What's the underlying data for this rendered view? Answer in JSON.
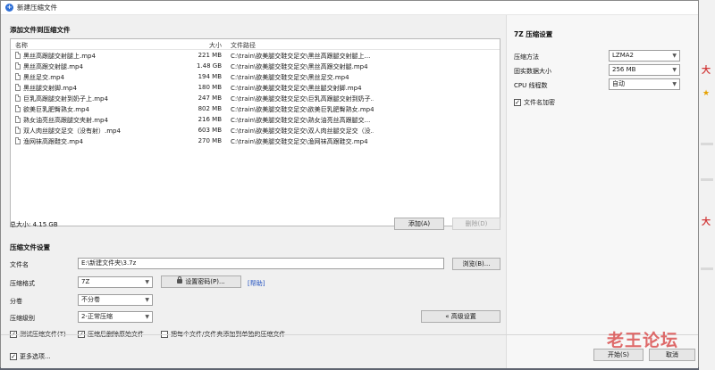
{
  "window": {
    "title": "新建压缩文件"
  },
  "files_section": {
    "title": "添加文件到压缩文件",
    "columns": {
      "name": "名称",
      "size": "大小",
      "path": "文件路径"
    },
    "rows": [
      {
        "name": "黑丝高跟腿交射腿上.mp4",
        "size": "221 MB",
        "path": "C:\\train\\欲美腿交鞋交足交\\黑丝高跟腿交射腿上..."
      },
      {
        "name": "黑丝高跟交射腿.mp4",
        "size": "1.48 GB",
        "path": "C:\\train\\欲美腿交鞋交足交\\黑丝高跟交射腿.mp4"
      },
      {
        "name": "黑丝足交.mp4",
        "size": "194 MB",
        "path": "C:\\train\\欲美腿交鞋交足交\\黑丝足交.mp4"
      },
      {
        "name": "黑丝腿交射脚.mp4",
        "size": "180 MB",
        "path": "C:\\train\\欲美腿交鞋交足交\\黑丝腿交射脚.mp4"
      },
      {
        "name": "巨乳高跟腿交射到奶子上.mp4",
        "size": "247 MB",
        "path": "C:\\train\\欲美腿交鞋交足交\\巨乳高跟腿交射到奶子..."
      },
      {
        "name": "欲美巨乳肥臀熟女.mp4",
        "size": "802 MB",
        "path": "C:\\train\\欲美腿交鞋交足交\\欲美巨乳肥臀熟女.mp4"
      },
      {
        "name": "熟女油亮丝高跟腿交夹射.mp4",
        "size": "216 MB",
        "path": "C:\\train\\欲美腿交鞋交足交\\熟女油亮丝高跟腿交..."
      },
      {
        "name": "双人肉丝腿交足交（没有射）.mp4",
        "size": "603 MB",
        "path": "C:\\train\\欲美腿交鞋交足交\\双人肉丝腿交足交（没..."
      },
      {
        "name": "渔网袜高跟鞋交.mp4",
        "size": "270 MB",
        "path": "C:\\train\\欲美腿交鞋交足交\\渔网袜高跟鞋交.mp4"
      }
    ],
    "total_size": "总大小: 4.15 GB",
    "add_label": "添加(A)",
    "delete_label": "删除(D)"
  },
  "settings_section": {
    "title": "压缩文件设置",
    "filename_label": "文件名",
    "filename_value": "E:\\新建文件夹\\3.7z",
    "browse_label": "浏览(B)...",
    "format_label": "压缩格式",
    "format_value": "7Z",
    "set_password_label": "设置密码(P)...",
    "help_label": "[帮助]",
    "split_label": "分卷",
    "split_value": "不分卷",
    "level_label": "压缩级别",
    "level_value": "2-正常压缩",
    "advanced_label": "« 高级设置",
    "test_archive_label": "测试压缩文件(T)",
    "delete_after_label": "压缩后删除原始文件",
    "separate_label": "把每个文件/文件夹添加到单独的压缩文件",
    "more_options_label": "更多选项..."
  },
  "seven_z": {
    "title": "7Z 压缩设置",
    "method_label": "压缩方法",
    "method_value": "LZMA2",
    "dict_label": "固实数据大小",
    "dict_value": "256 MB",
    "threads_label": "CPU 线程数",
    "threads_value": "自动",
    "encrypt_label": "文件名加密"
  },
  "footer": {
    "start_label": "开始(S)",
    "cancel_label": "取消"
  },
  "watermark": "老王论坛",
  "colors": {
    "accent": "#2f6fd6",
    "link": "#1f4fbf",
    "watermark": "#d94a4a"
  }
}
